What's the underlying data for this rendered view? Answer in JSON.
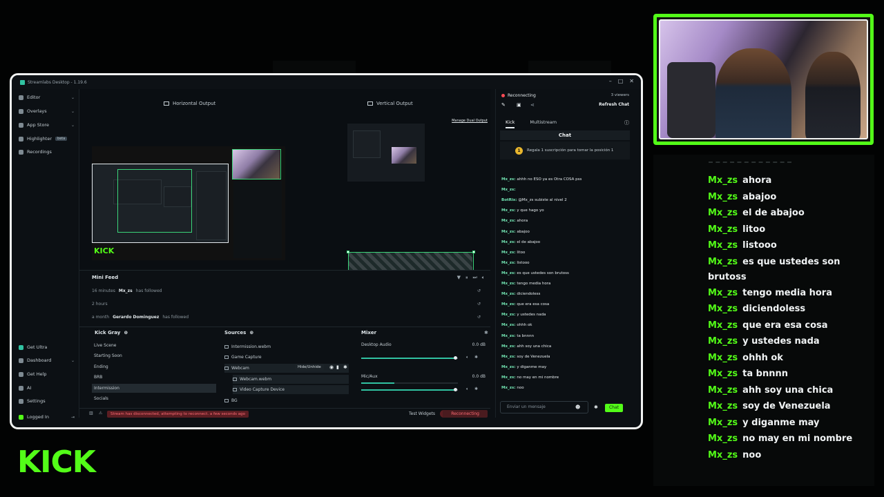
{
  "window": {
    "title": "Streamlabs Desktop - 1.19.6",
    "controls": [
      "–",
      "□",
      "✕"
    ]
  },
  "sidebar": {
    "items": [
      {
        "label": "Editor",
        "icon": "editor-icon",
        "has_chevron": true
      },
      {
        "label": "Overlays",
        "icon": "overlays-icon",
        "has_chevron": true
      },
      {
        "label": "App Store",
        "icon": "store-icon",
        "has_chevron": true
      },
      {
        "label": "Highlighter",
        "icon": "highlighter-icon",
        "badge": "beta"
      },
      {
        "label": "Recordings",
        "icon": "recordings-icon"
      }
    ],
    "bottom_items": [
      {
        "label": "Get Ultra",
        "icon": "ultra-icon"
      },
      {
        "label": "Dashboard",
        "icon": "dashboard-icon",
        "has_chevron": true
      },
      {
        "label": "Get Help",
        "icon": "help-icon"
      },
      {
        "label": "AI",
        "icon": "ai-icon"
      },
      {
        "label": "Settings",
        "icon": "gear-icon"
      },
      {
        "label": "Logged In",
        "icon": "kick-icon"
      }
    ]
  },
  "preview": {
    "horizontal_label": "Horizontal Output",
    "vertical_label": "Vertical Output",
    "manage_label": "Manage Dual Output",
    "kick_logo": "KICK"
  },
  "mini_feed": {
    "title": "Mini Feed",
    "rows": [
      {
        "time": "16 minutes",
        "user": "Mx_zs",
        "action": "has followed"
      },
      {
        "time": "2 hours",
        "user": "",
        "action": ""
      },
      {
        "time": "a month",
        "user": "Gerardo Dominguez",
        "action": "has followed"
      }
    ]
  },
  "scenes": {
    "title": "Kick Gray",
    "items": [
      "Live Scene",
      "Starting Soon",
      "Ending",
      "BRB",
      "Intermission",
      "Socials"
    ],
    "active": "Intermission"
  },
  "sources": {
    "title": "Sources",
    "items": [
      {
        "label": "Intermission.webm",
        "indent": 0
      },
      {
        "label": "Game Capture",
        "indent": 0
      },
      {
        "label": "Webcam",
        "indent": 0
      },
      {
        "label": "Webcam.webm",
        "indent": 1
      },
      {
        "label": "Video Capture Device",
        "indent": 1
      },
      {
        "label": "BG",
        "indent": 0
      }
    ],
    "tooltip": "Hide/Unhide"
  },
  "mixer": {
    "title": "Mixer",
    "channels": [
      {
        "label": "Desktop Audio",
        "db": "0.0 dB",
        "level": 0.0,
        "volume": 0.98
      },
      {
        "label": "Mic/Aux",
        "db": "0.0 dB",
        "level": 0.34,
        "volume": 0.98
      }
    ]
  },
  "status": {
    "error": "Stream has disconnected, attempting to reconnect. a few seconds ago",
    "test_widgets": "Test Widgets",
    "reconnecting_button": "Reconnecting"
  },
  "chat_panel": {
    "status": "Reconnecting",
    "viewers": "3 viewers",
    "refresh": "Refresh Chat",
    "tabs": [
      "Kick",
      "Multistream"
    ],
    "header": "Chat",
    "pinned": "Regala 1 suscripción para tomar la posición 1",
    "pinned_badge": "1",
    "messages": [
      {
        "user": "Mx_zs",
        "text": "ahhh no ESO ya es Otra COSA pss"
      },
      {
        "user": "Mx_zs",
        "text": ""
      },
      {
        "user": "BotRix",
        "text": "@Mx_zs subiste al nivel 2"
      },
      {
        "user": "Mx_zs",
        "text": "y que hago yo"
      },
      {
        "user": "Mx_zs",
        "text": "ahora"
      },
      {
        "user": "Mx_zs",
        "text": "abajoo"
      },
      {
        "user": "Mx_zs",
        "text": "el de abajoo"
      },
      {
        "user": "Mx_zs",
        "text": "litoo"
      },
      {
        "user": "Mx_zs",
        "text": "listooo"
      },
      {
        "user": "Mx_zs",
        "text": "es que ustedes son brutoss"
      },
      {
        "user": "Mx_zs",
        "text": "tengo media hora"
      },
      {
        "user": "Mx_zs",
        "text": "diciendoless"
      },
      {
        "user": "Mx_zs",
        "text": "que era esa cosa"
      },
      {
        "user": "Mx_zs",
        "text": "y ustedes nada"
      },
      {
        "user": "Mx_zs",
        "text": "ohhh ok"
      },
      {
        "user": "Mx_zs",
        "text": "ta bnnnn"
      },
      {
        "user": "Mx_zs",
        "text": "ahh soy una chica"
      },
      {
        "user": "Mx_zs",
        "text": "soy de Venezuela"
      },
      {
        "user": "Mx_zs",
        "text": "y diganme may"
      },
      {
        "user": "Mx_zs",
        "text": "no may en mi nombre"
      },
      {
        "user": "Mx_zs",
        "text": "noo"
      }
    ],
    "input_placeholder": "Enviar un mensaje",
    "send_label": "Chat"
  },
  "overlay_chat": {
    "messages": [
      {
        "user": "Mx_zs",
        "text": "ahora"
      },
      {
        "user": "Mx_zs",
        "text": "abajoo"
      },
      {
        "user": "Mx_zs",
        "text": "el de abajoo"
      },
      {
        "user": "Mx_zs",
        "text": "litoo"
      },
      {
        "user": "Mx_zs",
        "text": "listooo"
      },
      {
        "user": "Mx_zs",
        "text": "es que ustedes son brutoss"
      },
      {
        "user": "Mx_zs",
        "text": "tengo media hora"
      },
      {
        "user": "Mx_zs",
        "text": "diciendoless"
      },
      {
        "user": "Mx_zs",
        "text": "que era esa cosa"
      },
      {
        "user": "Mx_zs",
        "text": "y ustedes nada"
      },
      {
        "user": "Mx_zs",
        "text": "ohhh ok"
      },
      {
        "user": "Mx_zs",
        "text": "ta bnnnn"
      },
      {
        "user": "Mx_zs",
        "text": "ahh soy una chica"
      },
      {
        "user": "Mx_zs",
        "text": "soy de Venezuela"
      },
      {
        "user": "Mx_zs",
        "text": "y diganme may"
      },
      {
        "user": "Mx_zs",
        "text": "no may en mi nombre"
      },
      {
        "user": "Mx_zs",
        "text": "noo"
      }
    ]
  },
  "branding": {
    "kick_logo": "KICK",
    "accent": "#53fc18"
  }
}
